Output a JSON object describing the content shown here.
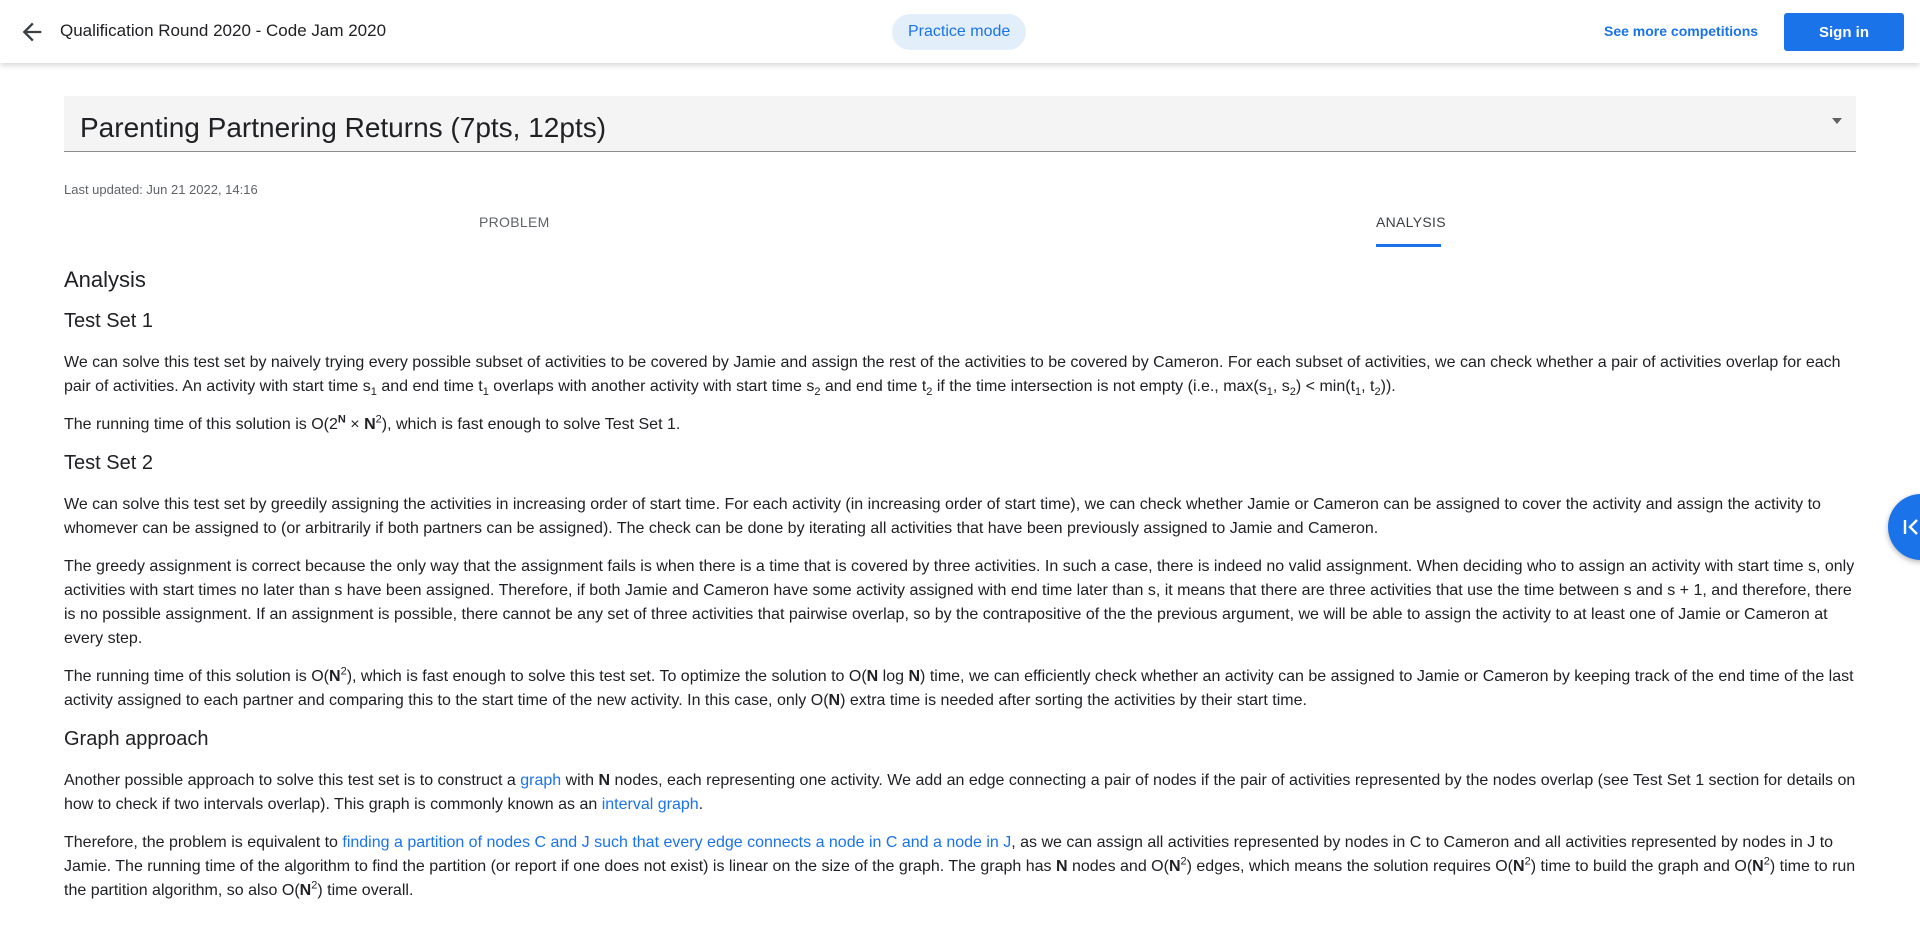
{
  "header": {
    "title": "Qualification Round 2020 - Code Jam 2020",
    "practice_mode": "Practice mode",
    "see_more": "See more competitions",
    "sign_in": "Sign in",
    "back_icon": "arrow-back-icon"
  },
  "problem": {
    "title": "Parenting Partnering Returns (7pts, 12pts)",
    "last_updated": "Last updated: Jun 21 2022, 14:16",
    "dropdown_icon": "chevron-down-icon"
  },
  "tabs": [
    {
      "label": "PROBLEM",
      "active": false
    },
    {
      "label": "ANALYSIS",
      "active": true
    }
  ],
  "analysis": {
    "heading": "Analysis",
    "ts1_heading": "Test Set 1",
    "ts1_p1": [
      "We can solve this test set by naively trying every possible subset of activities to be covered by Jamie and assign the rest of the activities to be covered by Cameron. For each subset of activities, we can check whether a pair of activities overlap for each pair of activities. An activity with start time s",
      "1",
      " and end time t",
      "1",
      " overlaps with another activity with start time s",
      "2",
      " and end time t",
      "2",
      " if the time intersection is not empty (i.e., max(s",
      "1",
      ", s",
      "2",
      ") < min(t",
      "1",
      ", t",
      "2",
      "))."
    ],
    "ts1_p2": [
      "The running time of this solution is O(2",
      "N",
      " × ",
      "N",
      "2",
      "), which is fast enough to solve Test Set 1."
    ],
    "ts2_heading": "Test Set 2",
    "ts2_p1": "We can solve this test set by greedily assigning the activities in increasing order of start time. For each activity (in increasing order of start time), we can check whether Jamie or Cameron can be assigned to cover the activity and assign the activity to whomever can be assigned to (or arbitrarily if both partners can be assigned). The check can be done by iterating all activities that have been previously assigned to Jamie and Cameron.",
    "ts2_p2": "The greedy assignment is correct because the only way that the assignment fails is when there is a time that is covered by three activities. In such a case, there is indeed no valid assignment. When deciding who to assign an activity with start time s, only activities with start times no later than s have been assigned. Therefore, if both Jamie and Cameron have some activity assigned with end time later than s, it means that there are three activities that use the time between s and s + 1, and therefore, there is no possible assignment. If an assignment is possible, there cannot be any set of three activities that pairwise overlap, so by the contrapositive of the the previous argument, we will be able to assign the activity to at least one of Jamie or Cameron at every step.",
    "ts2_p3": [
      "The running time of this solution is O(",
      "N",
      "2",
      "), which is fast enough to solve this test set. To optimize the solution to O(",
      "N",
      " log ",
      "N",
      ") time, we can efficiently check whether an activity can be assigned to Jamie or Cameron by keeping track of the end time of the last activity assigned to each partner and comparing this to the start time of the new activity. In this case, only O(",
      "N",
      ") extra time is needed after sorting the activities by their start time."
    ],
    "graph_heading": "Graph approach",
    "graph_p1": [
      "Another possible approach to solve this test set is to construct a ",
      "graph",
      " with ",
      "N",
      " nodes, each representing one activity. We add an edge connecting a pair of nodes if the pair of activities represented by the nodes overlap (see Test Set 1 section for details on how to check if two intervals overlap). This graph is commonly known as an ",
      "interval graph",
      "."
    ],
    "graph_p2": [
      "Therefore, the problem is equivalent to ",
      "finding a partition of nodes C and J such that every edge connects a node in C and a node in J",
      ", as we can assign all activities represented by nodes in C to Cameron and all activities represented by nodes in J to Jamie. The running time of the algorithm to find the partition (or report if one does not exist) is linear on the size of the graph. The graph has ",
      "N",
      " nodes and O(",
      "N",
      "2",
      ") edges, which means the solution requires O(",
      "N",
      "2",
      ") time to build the graph and O(",
      "N",
      "2",
      ") time to run the partition algorithm, so also O(",
      "N",
      "2",
      ") time overall."
    ]
  },
  "side_fab_icon": "collapse-panel-icon",
  "colors": {
    "accent": "#1a73e8",
    "chip_bg": "#e3eefb",
    "select_bg": "#f4f4f4"
  }
}
